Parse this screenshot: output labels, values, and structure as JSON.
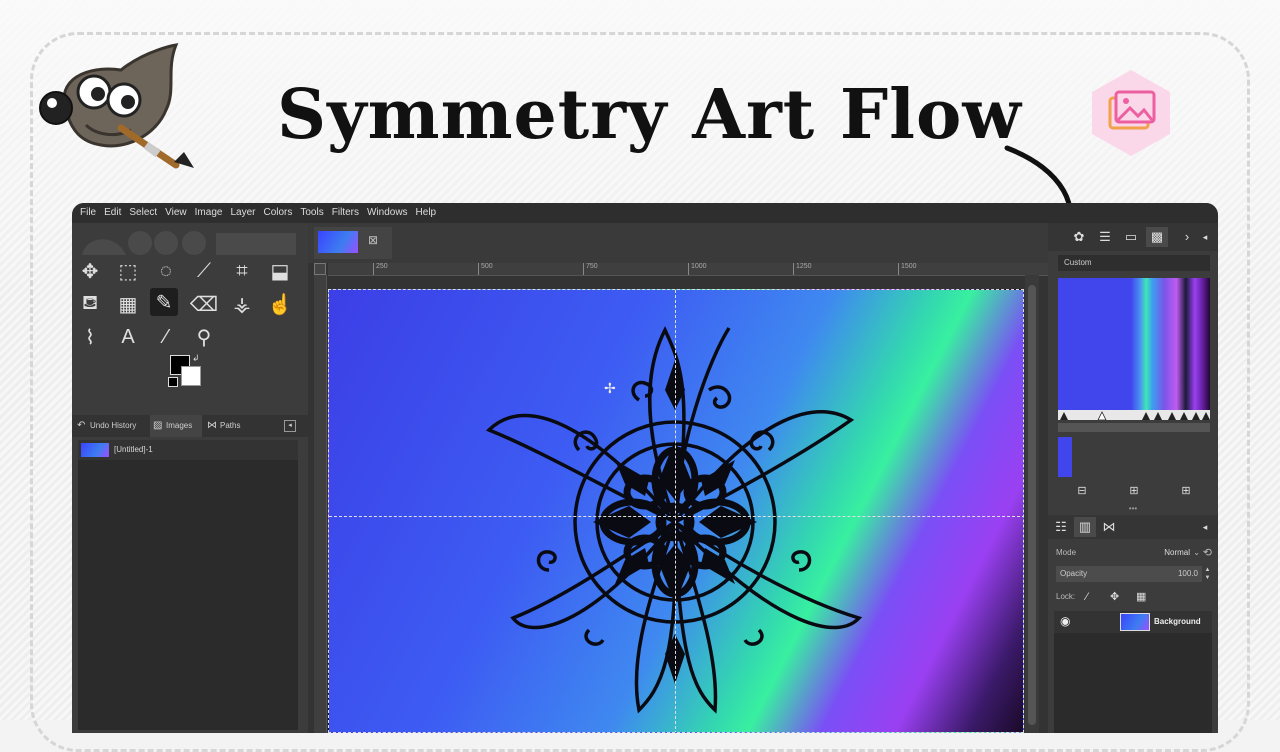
{
  "title": "Symmetry Art Flow",
  "menu": [
    "File",
    "Edit",
    "Select",
    "View",
    "Image",
    "Layer",
    "Colors",
    "Tools",
    "Filters",
    "Windows",
    "Help"
  ],
  "dock_tabs": {
    "undo_history": "Undo History",
    "images": "Images",
    "paths": "Paths"
  },
  "images_list": [
    {
      "label": "[Untitled]-1"
    }
  ],
  "ruler": {
    "labels": [
      "250",
      "500",
      "750",
      "1000",
      "1250",
      "1500"
    ]
  },
  "gradient": {
    "combo_label": "Custom"
  },
  "layers": {
    "mode_label": "Mode",
    "mode_value": "Normal",
    "opacity_label": "Opacity",
    "opacity_value": "100.0",
    "lock_label": "Lock:",
    "items": [
      {
        "name": "Background"
      }
    ]
  },
  "colors": {
    "foreground": "#000000",
    "background": "#ffffff",
    "accent_pink": "#fbd7ea",
    "canvas_blue": "#3c3fe6"
  },
  "icons": [
    "move-tool-icon",
    "rect-select-icon",
    "lasso-icon",
    "fuzzy-select-icon",
    "crop-icon",
    "transform-icon",
    "bucket-fill-icon",
    "gradient-icon",
    "paintbrush-icon",
    "eraser-icon",
    "clone-icon",
    "smudge-icon",
    "paths-icon",
    "text-icon",
    "color-picker-icon",
    "zoom-icon"
  ]
}
